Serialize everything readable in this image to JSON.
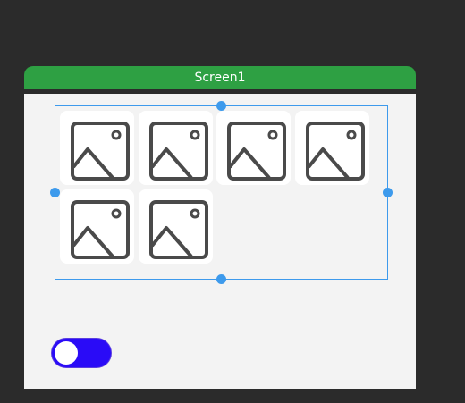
{
  "screen": {
    "title": "Screen1",
    "header_color": "#2ea043",
    "body_color": "#f3f3f3"
  },
  "gallery": {
    "item_icon": "image-placeholder-icon",
    "item_count": 6,
    "selected": true,
    "selection_color": "#3d9aec"
  },
  "toggle": {
    "state": "off",
    "color": "#2a0bf7"
  }
}
